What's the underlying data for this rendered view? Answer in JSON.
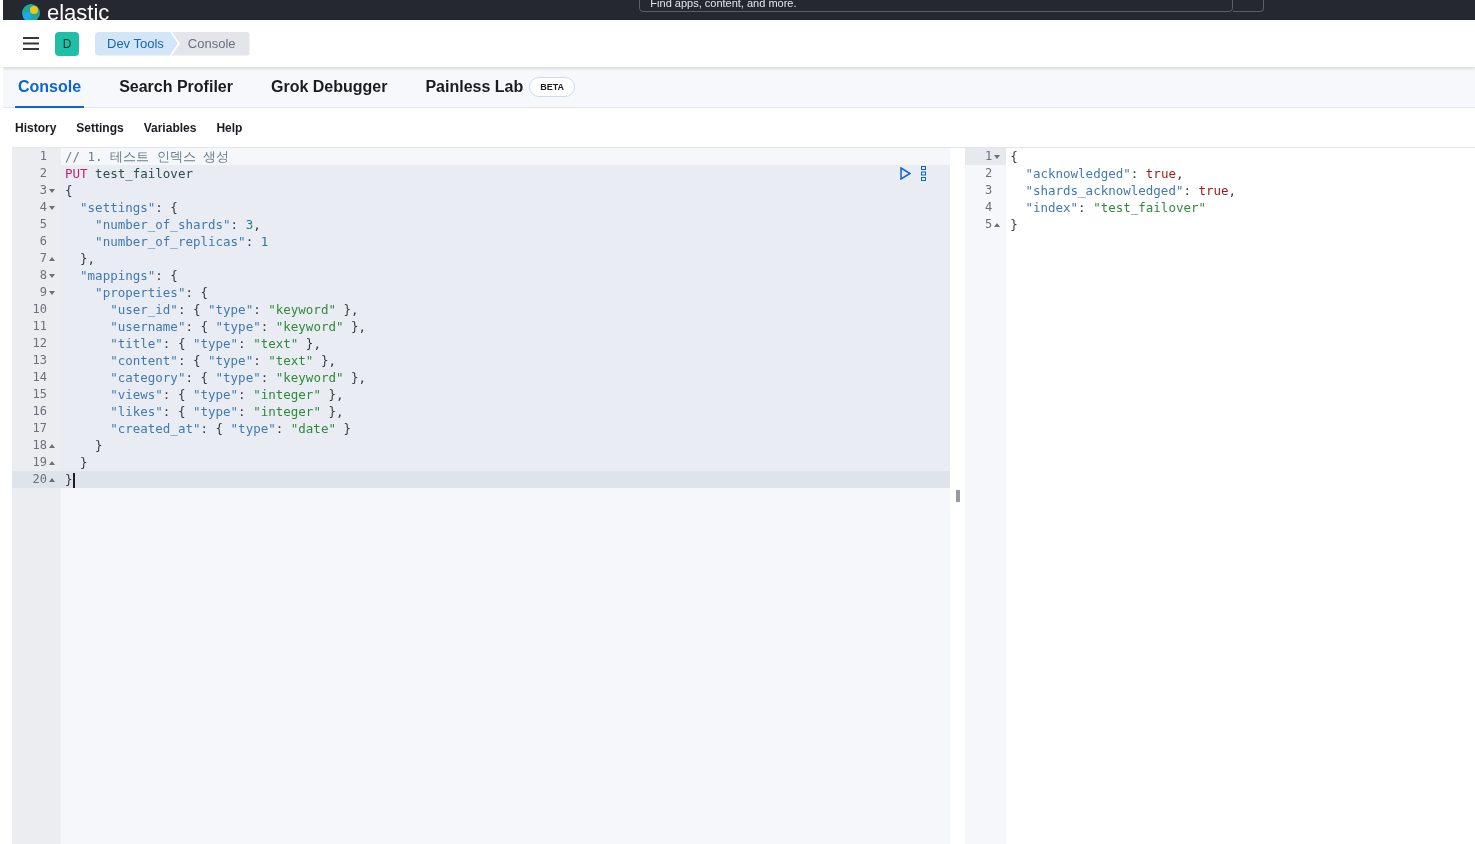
{
  "top_bar": {
    "logo_text": "elastic",
    "search": {
      "placeholder": "Find apps, content, and more."
    }
  },
  "header": {
    "avatar": "D",
    "breadcrumbs": [
      {
        "label": "Dev Tools",
        "selected": false
      },
      {
        "label": "Console",
        "selected": true
      }
    ]
  },
  "tabs": [
    {
      "label": "Console",
      "selected": true
    },
    {
      "label": "Search Profiler",
      "selected": false
    },
    {
      "label": "Grok Debugger",
      "selected": false
    },
    {
      "label": "Painless Lab",
      "selected": false,
      "badge": "BETA"
    }
  ],
  "toolbar": [
    "History",
    "Settings",
    "Variables",
    "Help"
  ],
  "request_editor": {
    "lines": [
      {
        "n": "1",
        "kind": "plain",
        "in_request": false,
        "active": false,
        "tokens": [
          {
            "kind": "comment",
            "text": "// 1. 테스트 인덱스 생성"
          }
        ]
      },
      {
        "n": "2",
        "kind": "plain",
        "in_request": true,
        "active": false,
        "tokens": [
          {
            "kind": "method",
            "text": "PUT"
          },
          {
            "kind": "url",
            "text": " test_failover"
          }
        ]
      },
      {
        "n": "3",
        "kind": "open",
        "in_request": true,
        "active": false,
        "tokens": [
          {
            "kind": "punct",
            "text": "{"
          }
        ]
      },
      {
        "n": "4",
        "kind": "open",
        "in_request": true,
        "active": false,
        "tokens": [
          {
            "kind": "key",
            "text": "  \"settings\""
          },
          {
            "kind": "punct",
            "text": ": {"
          }
        ]
      },
      {
        "n": "5",
        "kind": "plain",
        "in_request": true,
        "active": false,
        "tokens": [
          {
            "kind": "key",
            "text": "    \"number_of_shards\""
          },
          {
            "kind": "punct",
            "text": ": "
          },
          {
            "kind": "number",
            "text": "3"
          },
          {
            "kind": "punct",
            "text": ","
          }
        ]
      },
      {
        "n": "6",
        "kind": "plain",
        "in_request": true,
        "active": false,
        "tokens": [
          {
            "kind": "key",
            "text": "    \"number_of_replicas\""
          },
          {
            "kind": "punct",
            "text": ": "
          },
          {
            "kind": "number",
            "text": "1"
          }
        ]
      },
      {
        "n": "7",
        "kind": "close",
        "in_request": true,
        "active": false,
        "tokens": [
          {
            "kind": "punct",
            "text": "  },"
          }
        ]
      },
      {
        "n": "8",
        "kind": "open",
        "in_request": true,
        "active": false,
        "tokens": [
          {
            "kind": "key",
            "text": "  \"mappings\""
          },
          {
            "kind": "punct",
            "text": ": {"
          }
        ]
      },
      {
        "n": "9",
        "kind": "open",
        "in_request": true,
        "active": false,
        "tokens": [
          {
            "kind": "key",
            "text": "    \"properties\""
          },
          {
            "kind": "punct",
            "text": ": {"
          }
        ]
      },
      {
        "n": "10",
        "kind": "plain",
        "in_request": true,
        "active": false,
        "tokens": [
          {
            "kind": "key",
            "text": "      \"user_id\""
          },
          {
            "kind": "punct",
            "text": ": { "
          },
          {
            "kind": "key",
            "text": "\"type\""
          },
          {
            "kind": "punct",
            "text": ": "
          },
          {
            "kind": "string",
            "text": "\"keyword\""
          },
          {
            "kind": "punct",
            "text": " },"
          }
        ]
      },
      {
        "n": "11",
        "kind": "plain",
        "in_request": true,
        "active": false,
        "tokens": [
          {
            "kind": "key",
            "text": "      \"username\""
          },
          {
            "kind": "punct",
            "text": ": { "
          },
          {
            "kind": "key",
            "text": "\"type\""
          },
          {
            "kind": "punct",
            "text": ": "
          },
          {
            "kind": "string",
            "text": "\"keyword\""
          },
          {
            "kind": "punct",
            "text": " },"
          }
        ]
      },
      {
        "n": "12",
        "kind": "plain",
        "in_request": true,
        "active": false,
        "tokens": [
          {
            "kind": "key",
            "text": "      \"title\""
          },
          {
            "kind": "punct",
            "text": ": { "
          },
          {
            "kind": "key",
            "text": "\"type\""
          },
          {
            "kind": "punct",
            "text": ": "
          },
          {
            "kind": "string",
            "text": "\"text\""
          },
          {
            "kind": "punct",
            "text": " },"
          }
        ]
      },
      {
        "n": "13",
        "kind": "plain",
        "in_request": true,
        "active": false,
        "tokens": [
          {
            "kind": "key",
            "text": "      \"content\""
          },
          {
            "kind": "punct",
            "text": ": { "
          },
          {
            "kind": "key",
            "text": "\"type\""
          },
          {
            "kind": "punct",
            "text": ": "
          },
          {
            "kind": "string",
            "text": "\"text\""
          },
          {
            "kind": "punct",
            "text": " },"
          }
        ]
      },
      {
        "n": "14",
        "kind": "plain",
        "in_request": true,
        "active": false,
        "tokens": [
          {
            "kind": "key",
            "text": "      \"category\""
          },
          {
            "kind": "punct",
            "text": ": { "
          },
          {
            "kind": "key",
            "text": "\"type\""
          },
          {
            "kind": "punct",
            "text": ": "
          },
          {
            "kind": "string",
            "text": "\"keyword\""
          },
          {
            "kind": "punct",
            "text": " },"
          }
        ]
      },
      {
        "n": "15",
        "kind": "plain",
        "in_request": true,
        "active": false,
        "tokens": [
          {
            "kind": "key",
            "text": "      \"views\""
          },
          {
            "kind": "punct",
            "text": ": { "
          },
          {
            "kind": "key",
            "text": "\"type\""
          },
          {
            "kind": "punct",
            "text": ": "
          },
          {
            "kind": "string",
            "text": "\"integer\""
          },
          {
            "kind": "punct",
            "text": " },"
          }
        ]
      },
      {
        "n": "16",
        "kind": "plain",
        "in_request": true,
        "active": false,
        "tokens": [
          {
            "kind": "key",
            "text": "      \"likes\""
          },
          {
            "kind": "punct",
            "text": ": { "
          },
          {
            "kind": "key",
            "text": "\"type\""
          },
          {
            "kind": "punct",
            "text": ": "
          },
          {
            "kind": "string",
            "text": "\"integer\""
          },
          {
            "kind": "punct",
            "text": " },"
          }
        ]
      },
      {
        "n": "17",
        "kind": "plain",
        "in_request": true,
        "active": false,
        "tokens": [
          {
            "kind": "key",
            "text": "      \"created_at\""
          },
          {
            "kind": "punct",
            "text": ": { "
          },
          {
            "kind": "key",
            "text": "\"type\""
          },
          {
            "kind": "punct",
            "text": ": "
          },
          {
            "kind": "string",
            "text": "\"date\""
          },
          {
            "kind": "punct",
            "text": " }"
          }
        ]
      },
      {
        "n": "18",
        "kind": "close",
        "in_request": true,
        "active": false,
        "tokens": [
          {
            "kind": "punct",
            "text": "    }"
          }
        ]
      },
      {
        "n": "19",
        "kind": "close",
        "in_request": true,
        "active": false,
        "tokens": [
          {
            "kind": "punct",
            "text": "  }"
          }
        ]
      },
      {
        "n": "20",
        "kind": "close",
        "in_request": true,
        "active": true,
        "tokens": [
          {
            "kind": "punct",
            "text": "}"
          }
        ]
      }
    ]
  },
  "response_editor": {
    "lines": [
      {
        "n": "1",
        "kind": "open",
        "active": true,
        "tokens": [
          {
            "kind": "punct",
            "text": "{"
          }
        ]
      },
      {
        "n": "2",
        "kind": "plain",
        "active": false,
        "tokens": [
          {
            "kind": "key",
            "text": "  \"acknowledged\""
          },
          {
            "kind": "punct",
            "text": ": "
          },
          {
            "kind": "bool",
            "text": "true"
          },
          {
            "kind": "punct",
            "text": ","
          }
        ]
      },
      {
        "n": "3",
        "kind": "plain",
        "active": false,
        "tokens": [
          {
            "kind": "key",
            "text": "  \"shards_acknowledged\""
          },
          {
            "kind": "punct",
            "text": ": "
          },
          {
            "kind": "bool",
            "text": "true"
          },
          {
            "kind": "punct",
            "text": ","
          }
        ]
      },
      {
        "n": "4",
        "kind": "plain",
        "active": false,
        "tokens": [
          {
            "kind": "key",
            "text": "  \"index\""
          },
          {
            "kind": "punct",
            "text": ": "
          },
          {
            "kind": "string",
            "text": "\"test_failover\""
          }
        ]
      },
      {
        "n": "5",
        "kind": "close",
        "active": false,
        "tokens": [
          {
            "kind": "punct",
            "text": "}"
          }
        ]
      }
    ]
  }
}
